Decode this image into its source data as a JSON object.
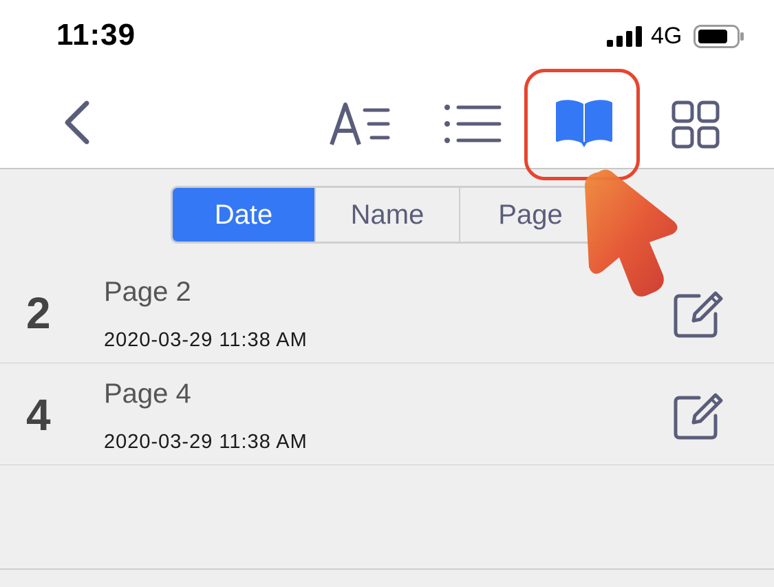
{
  "status_bar": {
    "time": "11:39",
    "network": "4G"
  },
  "toolbar": {
    "buttons": [
      {
        "name": "back",
        "icon": "chevron-left-icon"
      },
      {
        "name": "font",
        "icon": "text-format-icon"
      },
      {
        "name": "list",
        "icon": "list-icon"
      },
      {
        "name": "book",
        "icon": "book-icon",
        "selected": true
      },
      {
        "name": "grid",
        "icon": "grid-icon"
      }
    ]
  },
  "sort": {
    "options": [
      "Date",
      "Name",
      "Page"
    ],
    "selected": "Date"
  },
  "bookmarks": [
    {
      "number": "2",
      "title": "Page 2",
      "date": "2020-03-29 11:38 AM"
    },
    {
      "number": "4",
      "title": "Page 4",
      "date": "2020-03-29 11:38 AM"
    }
  ],
  "colors": {
    "accent": "#3478f6",
    "icon": "#5a5d7a",
    "highlight": "#e8442f",
    "pointer": "#e8442f"
  }
}
